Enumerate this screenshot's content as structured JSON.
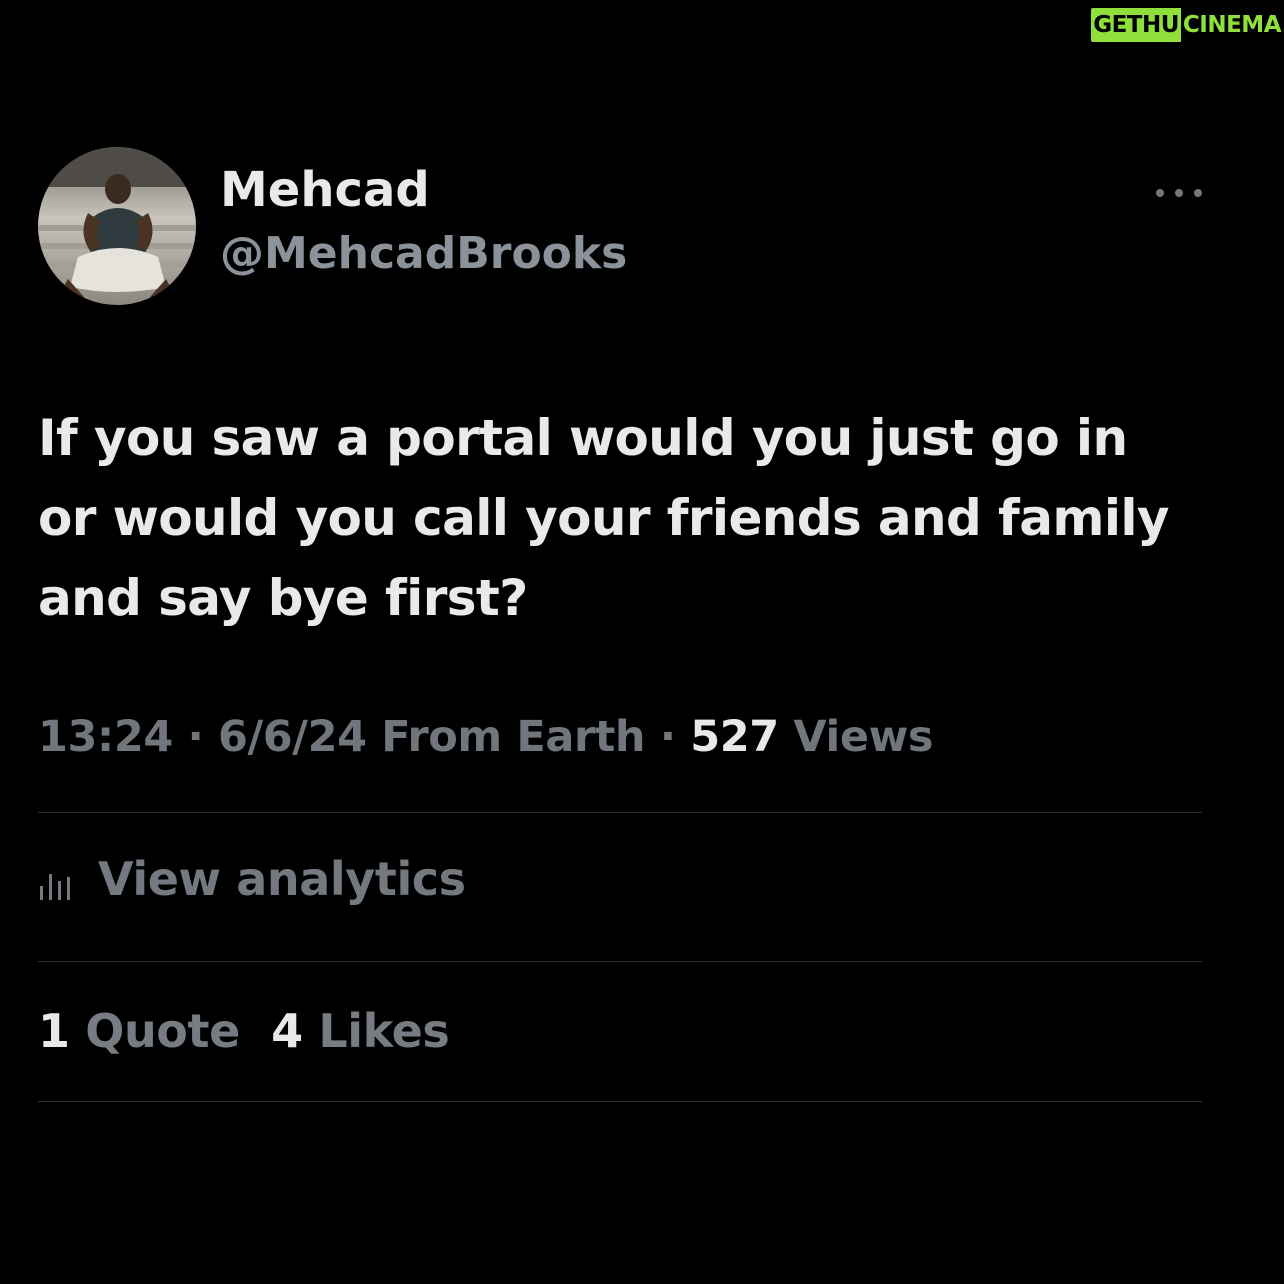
{
  "watermark": {
    "part1": "GETHU",
    "part2": "CINEMA"
  },
  "author": {
    "display_name": "Mehcad",
    "handle": "@MehcadBrooks"
  },
  "tweet": {
    "line1": "If you saw a portal would you just go in",
    "line2": "or would you call your friends and family",
    "line3": "and say bye first?"
  },
  "meta": {
    "time": "13:24",
    "sep1": " · ",
    "date": "6/6/24",
    "source": " From Earth",
    "sep2": " · ",
    "views_count": "527",
    "views_label": " Views"
  },
  "analytics": {
    "label": "View analytics",
    "icon": "bar-chart-icon"
  },
  "stats": {
    "quote_count": "1",
    "quote_label": "Quote",
    "likes_count": "4",
    "likes_label": "Likes"
  },
  "more_menu": {
    "icon": "more-horizontal-icon"
  },
  "colors": {
    "background": "#000000",
    "text_primary": "#e7e9ea",
    "text_secondary": "#71767b",
    "divider": "#2f3336",
    "watermark_green": "#8fe03a"
  }
}
